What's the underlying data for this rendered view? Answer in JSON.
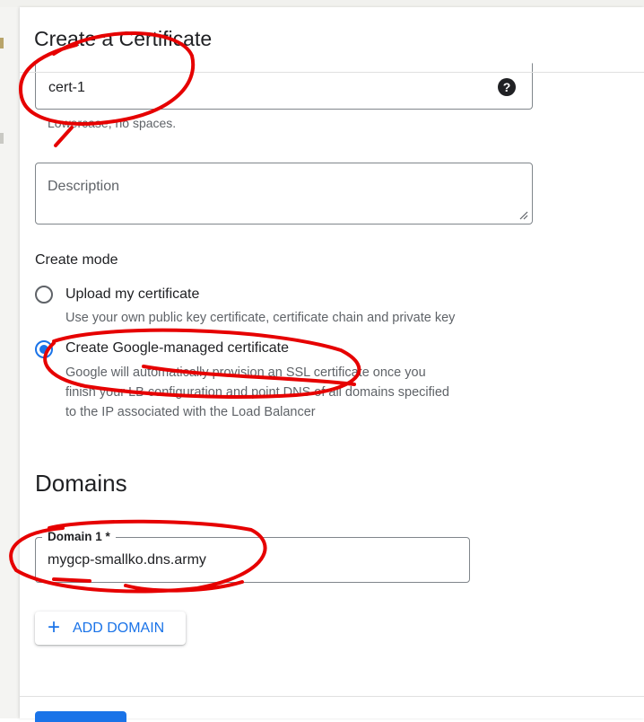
{
  "dialog": {
    "title": "Create a Certificate",
    "name_field": {
      "value": "cert-1",
      "help_icon": "help-circle-icon"
    },
    "name_hint": "Lowercase, no spaces.",
    "description_field": {
      "placeholder": "Description",
      "value": ""
    },
    "create_mode": {
      "label": "Create mode",
      "options": [
        {
          "label": "Upload my certificate",
          "description": "Use your own public key certificate, certificate chain and private key",
          "selected": false
        },
        {
          "label": "Create Google-managed certificate",
          "description_lines": [
            "Google will automatically provision an SSL certificate once you",
            "finish your LB configuration and point DNS of all domains specified",
            "to the IP associated with the Load Balancer"
          ],
          "selected": true
        }
      ]
    },
    "domains": {
      "heading": "Domains",
      "fields": [
        {
          "label": "Domain 1 *",
          "value": "mygcp-smallko.dns.army"
        }
      ],
      "add_button": {
        "icon": "plus-icon",
        "label": "ADD DOMAIN"
      }
    }
  },
  "colors": {
    "accent": "#1a73e8",
    "annotation": "#e60000",
    "text": "#202124",
    "secondary_text": "#5f6368"
  }
}
